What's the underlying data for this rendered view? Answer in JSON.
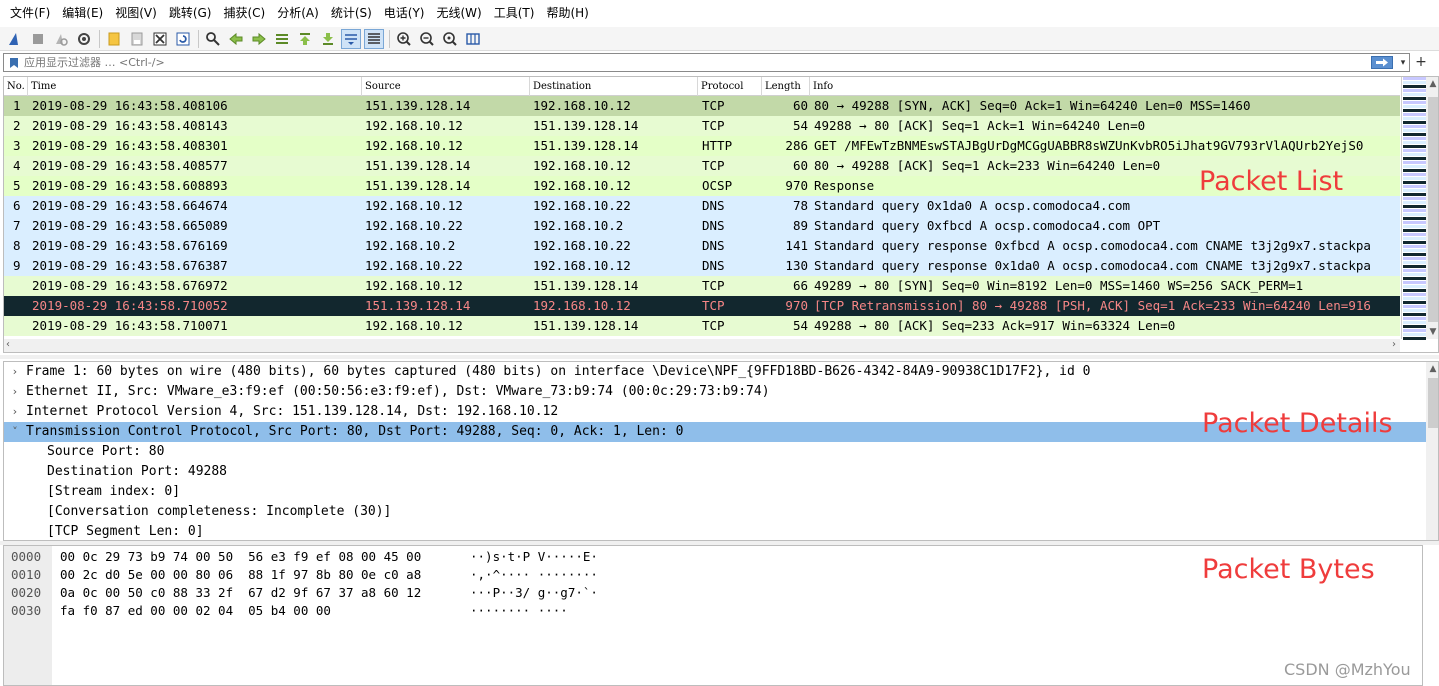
{
  "menu": [
    "文件(F)",
    "编辑(E)",
    "视图(V)",
    "跳转(G)",
    "捕获(C)",
    "分析(A)",
    "统计(S)",
    "电话(Y)",
    "无线(W)",
    "工具(T)",
    "帮助(H)"
  ],
  "toolbar": {
    "icons": [
      "shark-fin-start-icon",
      "stop-capture-icon",
      "restart-capture-icon",
      "capture-options-icon",
      "open-file-icon",
      "save-file-icon",
      "close-file-icon",
      "reload-file-icon",
      "find-packet-icon",
      "go-back-icon",
      "go-forward-icon",
      "go-to-packet-icon",
      "go-first-icon",
      "go-last-icon",
      "autoscroll-icon",
      "colorize-icon",
      "zoom-in-icon",
      "zoom-out-icon",
      "zoom-normal-icon",
      "resize-columns-icon"
    ]
  },
  "filter": {
    "placeholder": "应用显示过滤器 … <Ctrl-/>"
  },
  "packet_list": {
    "columns": [
      "No.",
      "Time",
      "Source",
      "Destination",
      "Protocol",
      "Length",
      "Info"
    ],
    "rows": [
      {
        "no": "1",
        "time": "2019-08-29 16:43:58.408106",
        "src": "151.139.128.14",
        "dst": "192.168.10.12",
        "proto": "TCP",
        "len": "60",
        "info": "80 → 49288 [SYN, ACK] Seq=0 Ack=1 Win=64240 Len=0 MSS=1460",
        "style": "row-tcp-sel"
      },
      {
        "no": "2",
        "time": "2019-08-29 16:43:58.408143",
        "src": "192.168.10.12",
        "dst": "151.139.128.14",
        "proto": "TCP",
        "len": "54",
        "info": "49288 → 80 [ACK] Seq=1 Ack=1 Win=64240 Len=0",
        "style": "row-tcp"
      },
      {
        "no": "3",
        "time": "2019-08-29 16:43:58.408301",
        "src": "192.168.10.12",
        "dst": "151.139.128.14",
        "proto": "HTTP",
        "len": "286",
        "info": "GET /MFEwTzBNMEswSTAJBgUrDgMCGgUABBR8sWZUnKvbRO5iJhat9GV793rVlAQUrb2YejS0",
        "style": "row-http"
      },
      {
        "no": "4",
        "time": "2019-08-29 16:43:58.408577",
        "src": "151.139.128.14",
        "dst": "192.168.10.12",
        "proto": "TCP",
        "len": "60",
        "info": "80 → 49288 [ACK] Seq=1 Ack=233 Win=64240 Len=0",
        "style": "row-tcp"
      },
      {
        "no": "5",
        "time": "2019-08-29 16:43:58.608893",
        "src": "151.139.128.14",
        "dst": "192.168.10.12",
        "proto": "OCSP",
        "len": "970",
        "info": "Response",
        "style": "row-http"
      },
      {
        "no": "6",
        "time": "2019-08-29 16:43:58.664674",
        "src": "192.168.10.12",
        "dst": "192.168.10.22",
        "proto": "DNS",
        "len": "78",
        "info": "Standard query 0x1da0 A ocsp.comodoca4.com",
        "style": "row-udp"
      },
      {
        "no": "7",
        "time": "2019-08-29 16:43:58.665089",
        "src": "192.168.10.22",
        "dst": "192.168.10.2",
        "proto": "DNS",
        "len": "89",
        "info": "Standard query 0xfbcd A ocsp.comodoca4.com OPT",
        "style": "row-udp"
      },
      {
        "no": "8",
        "time": "2019-08-29 16:43:58.676169",
        "src": "192.168.10.2",
        "dst": "192.168.10.22",
        "proto": "DNS",
        "len": "141",
        "info": "Standard query response 0xfbcd A ocsp.comodoca4.com CNAME t3j2g9x7.stackpa",
        "style": "row-udp"
      },
      {
        "no": "9",
        "time": "2019-08-29 16:43:58.676387",
        "src": "192.168.10.22",
        "dst": "192.168.10.12",
        "proto": "DNS",
        "len": "130",
        "info": "Standard query response 0x1da0 A ocsp.comodoca4.com CNAME t3j2g9x7.stackpa",
        "style": "row-udp"
      },
      {
        "no": "",
        "time": "2019-08-29 16:43:58.676972",
        "src": "192.168.10.12",
        "dst": "151.139.128.14",
        "proto": "TCP",
        "len": "66",
        "info": "49289 → 80 [SYN] Seq=0 Win=8192 Len=0 MSS=1460 WS=256 SACK_PERM=1",
        "style": "row-tcp"
      },
      {
        "no": "",
        "time": "2019-08-29 16:43:58.710052",
        "src": "151.139.128.14",
        "dst": "192.168.10.12",
        "proto": "TCP",
        "len": "970",
        "info": "[TCP Retransmission] 80 → 49288 [PSH, ACK] Seq=1 Ack=233 Win=64240 Len=916",
        "style": "row-bad"
      },
      {
        "no": "",
        "time": "2019-08-29 16:43:58.710071",
        "src": "192.168.10.12",
        "dst": "151.139.128.14",
        "proto": "TCP",
        "len": "54",
        "info": "49288 → 80 [ACK] Seq=233 Ack=917 Win=63324 Len=0",
        "style": "row-tcp"
      }
    ]
  },
  "details": {
    "rows": [
      {
        "arrow": "›",
        "text": "Frame 1: 60 bytes on wire (480 bits), 60 bytes captured (480 bits) on interface \\Device\\NPF_{9FFD18BD-B626-4342-84A9-90938C1D17F2}, id 0"
      },
      {
        "arrow": "›",
        "text": "Ethernet II, Src: VMware_e3:f9:ef (00:50:56:e3:f9:ef), Dst: VMware_73:b9:74 (00:0c:29:73:b9:74)"
      },
      {
        "arrow": "›",
        "text": "Internet Protocol Version 4, Src: 151.139.128.14, Dst: 192.168.10.12"
      },
      {
        "arrow": "˅",
        "text": "Transmission Control Protocol, Src Port: 80, Dst Port: 49288, Seq: 0, Ack: 1, Len: 0"
      },
      {
        "arrow": "",
        "text": "Source Port: 80"
      },
      {
        "arrow": "",
        "text": "Destination Port: 49288"
      },
      {
        "arrow": "",
        "text": "[Stream index: 0]"
      },
      {
        "arrow": "",
        "text": "[Conversation completeness: Incomplete (30)]"
      },
      {
        "arrow": "",
        "text": "[TCP Segment Len: 0]"
      }
    ]
  },
  "bytes": {
    "rows": [
      {
        "off": "0000",
        "hex": "00 0c 29 73 b9 74 00 50  56 e3 f9 ef 08 00 45 00",
        "asc": "··)s·t·P V·····E·"
      },
      {
        "off": "0010",
        "hex": "00 2c d0 5e 00 00 80 06  88 1f 97 8b 80 0e c0 a8",
        "asc": "·,·^···· ········"
      },
      {
        "off": "0020",
        "hex": "0a 0c 00 50 c0 88 33 2f  67 d2 9f 67 37 a8 60 12",
        "asc": "···P··3/ g··g7·`·"
      },
      {
        "off": "0030",
        "hex": "fa f0 87 ed 00 00 02 04  05 b4 00 00",
        "asc": "········ ····"
      }
    ]
  },
  "labels": {
    "packet_list": "Packet List",
    "packet_details": "Packet Details",
    "packet_bytes": "Packet Bytes"
  },
  "watermark": "CSDN @MzhYou",
  "colors": {
    "tcp_row": "#e7fbd2",
    "tcp_selected_row": "#c2d9a8",
    "http_row": "#e4ffc7",
    "udp_row": "#daeeff",
    "bad_row_bg": "#12272e",
    "bad_row_fg": "#f78787",
    "detail_selected": "#8fbeea",
    "annotation": "#ef3c3c"
  }
}
